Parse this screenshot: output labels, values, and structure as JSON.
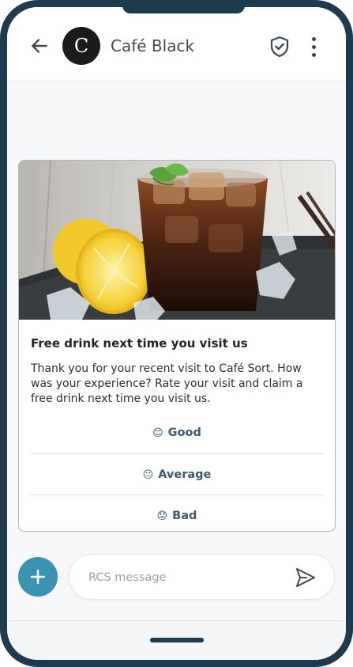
{
  "header": {
    "contact_name": "Café Black",
    "avatar_letter": "C",
    "icons": {
      "back": "arrow-left-icon",
      "verified": "shield-check-icon",
      "menu": "more-vertical-icon"
    }
  },
  "card": {
    "title": "Free drink next time you visit us",
    "description": "Thank you for your recent visit to Café Sort. How was your experience? Rate your visit and claim a free drink next time you visit us.",
    "replies": [
      {
        "emoji": "😊",
        "label": "Good"
      },
      {
        "emoji": "😐",
        "label": "Average"
      },
      {
        "emoji": "😟",
        "label": "Bad"
      }
    ]
  },
  "composer": {
    "placeholder": "RCS message",
    "value": "",
    "icons": {
      "add": "plus-icon",
      "send": "send-icon"
    }
  },
  "colors": {
    "frame": "#1d3a4f",
    "accent": "#3b93b4",
    "reply_text": "#3f5a70"
  }
}
